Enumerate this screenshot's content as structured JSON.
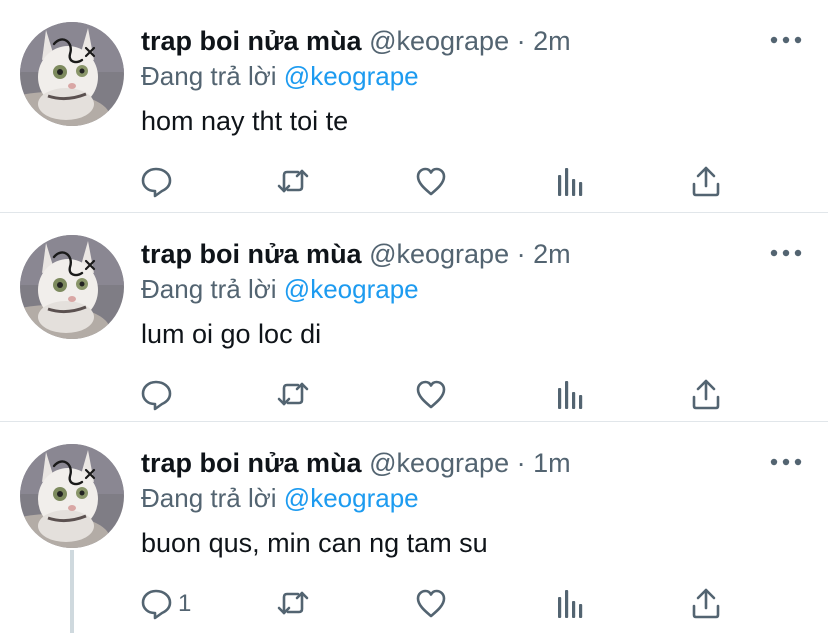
{
  "tweets": [
    {
      "display_name": "trap boi nửa mùa",
      "handle": "@keogrape",
      "separator": "·",
      "time": "2m",
      "reply_prefix": "Đang trả lời",
      "reply_to": "@keogrape",
      "text": "hom nay tht toi te",
      "reply_count": ""
    },
    {
      "display_name": "trap boi nửa mùa",
      "handle": "@keogrape",
      "separator": "·",
      "time": "2m",
      "reply_prefix": "Đang trả lời",
      "reply_to": "@keogrape",
      "text": "lum oi go loc di",
      "reply_count": ""
    },
    {
      "display_name": "trap boi nửa mùa",
      "handle": "@keogrape",
      "separator": "·",
      "time": "1m",
      "reply_prefix": "Đang trả lời",
      "reply_to": "@keogrape",
      "text": "buon qus, min can ng tam su",
      "reply_count": "1"
    }
  ],
  "icons": {
    "reply": "reply-icon",
    "retweet": "retweet-icon",
    "like": "heart-icon",
    "analytics": "analytics-icon",
    "share": "share-icon",
    "more": "more-icon"
  },
  "colors": {
    "text": "#0f1419",
    "secondary": "#536471",
    "accent": "#1d9bf0",
    "divider": "#e1e6ea"
  }
}
